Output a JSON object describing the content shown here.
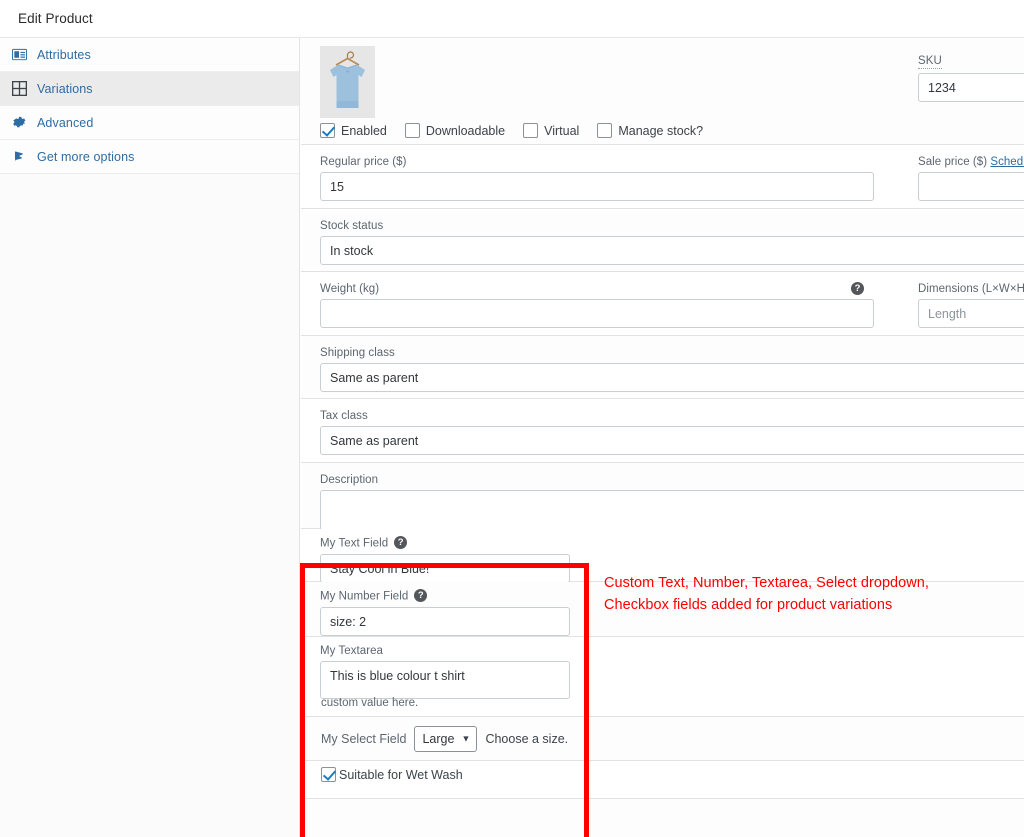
{
  "window": {
    "title": "Edit Product"
  },
  "sidebar": {
    "items": [
      {
        "label": "Attributes",
        "icon": "attributes-icon",
        "active": false
      },
      {
        "label": "Variations",
        "icon": "grid-icon",
        "active": true
      },
      {
        "label": "Advanced",
        "icon": "gear-icon",
        "active": false
      },
      {
        "label": "Get more options",
        "icon": "flag-icon",
        "active": false
      }
    ]
  },
  "variation": {
    "thumbnail_alt": "blue t-shirt on hanger",
    "sku": {
      "label": "SKU",
      "value": "1234"
    },
    "toggles": [
      {
        "label": "Enabled",
        "checked": true
      },
      {
        "label": "Downloadable",
        "checked": false
      },
      {
        "label": "Virtual",
        "checked": false
      },
      {
        "label": "Manage stock?",
        "checked": false
      }
    ],
    "regular_price": {
      "label": "Regular price ($)",
      "value": "15"
    },
    "sale_price": {
      "label": "Sale price ($)",
      "schedule_link": "Schedule",
      "value": ""
    },
    "stock_status": {
      "label": "Stock status",
      "value": "In stock"
    },
    "weight": {
      "label": "Weight (kg)",
      "value": "",
      "help": "?"
    },
    "dimensions": {
      "label": "Dimensions (L×W×H)",
      "placeholder": "Length",
      "value": ""
    },
    "shipping_class": {
      "label": "Shipping class",
      "value": "Same as parent"
    },
    "tax_class": {
      "label": "Tax class",
      "value": "Same as parent"
    },
    "description": {
      "label": "Description",
      "value": ""
    }
  },
  "custom_fields": {
    "text_field": {
      "label": "My Text Field",
      "help": "?",
      "value": "Stay Cool in Blue!"
    },
    "number_field": {
      "label": "My Number Field",
      "help": "?",
      "value": "size: 2"
    },
    "textarea_field": {
      "label": "My Textarea",
      "value": "This is blue colour t shirt",
      "description": "custom value here."
    },
    "select_field": {
      "label": "My Select Field",
      "value": "Large",
      "options": [
        "Large"
      ],
      "hint": "Choose a size."
    },
    "checkbox_field": {
      "label": "Suitable for Wet Wash",
      "checked": true
    }
  },
  "annotation": {
    "line1": "Custom Text, Number, Textarea, Select dropdown,",
    "line2": "Checkbox fields added for product variations",
    "color": "#fe0000"
  }
}
